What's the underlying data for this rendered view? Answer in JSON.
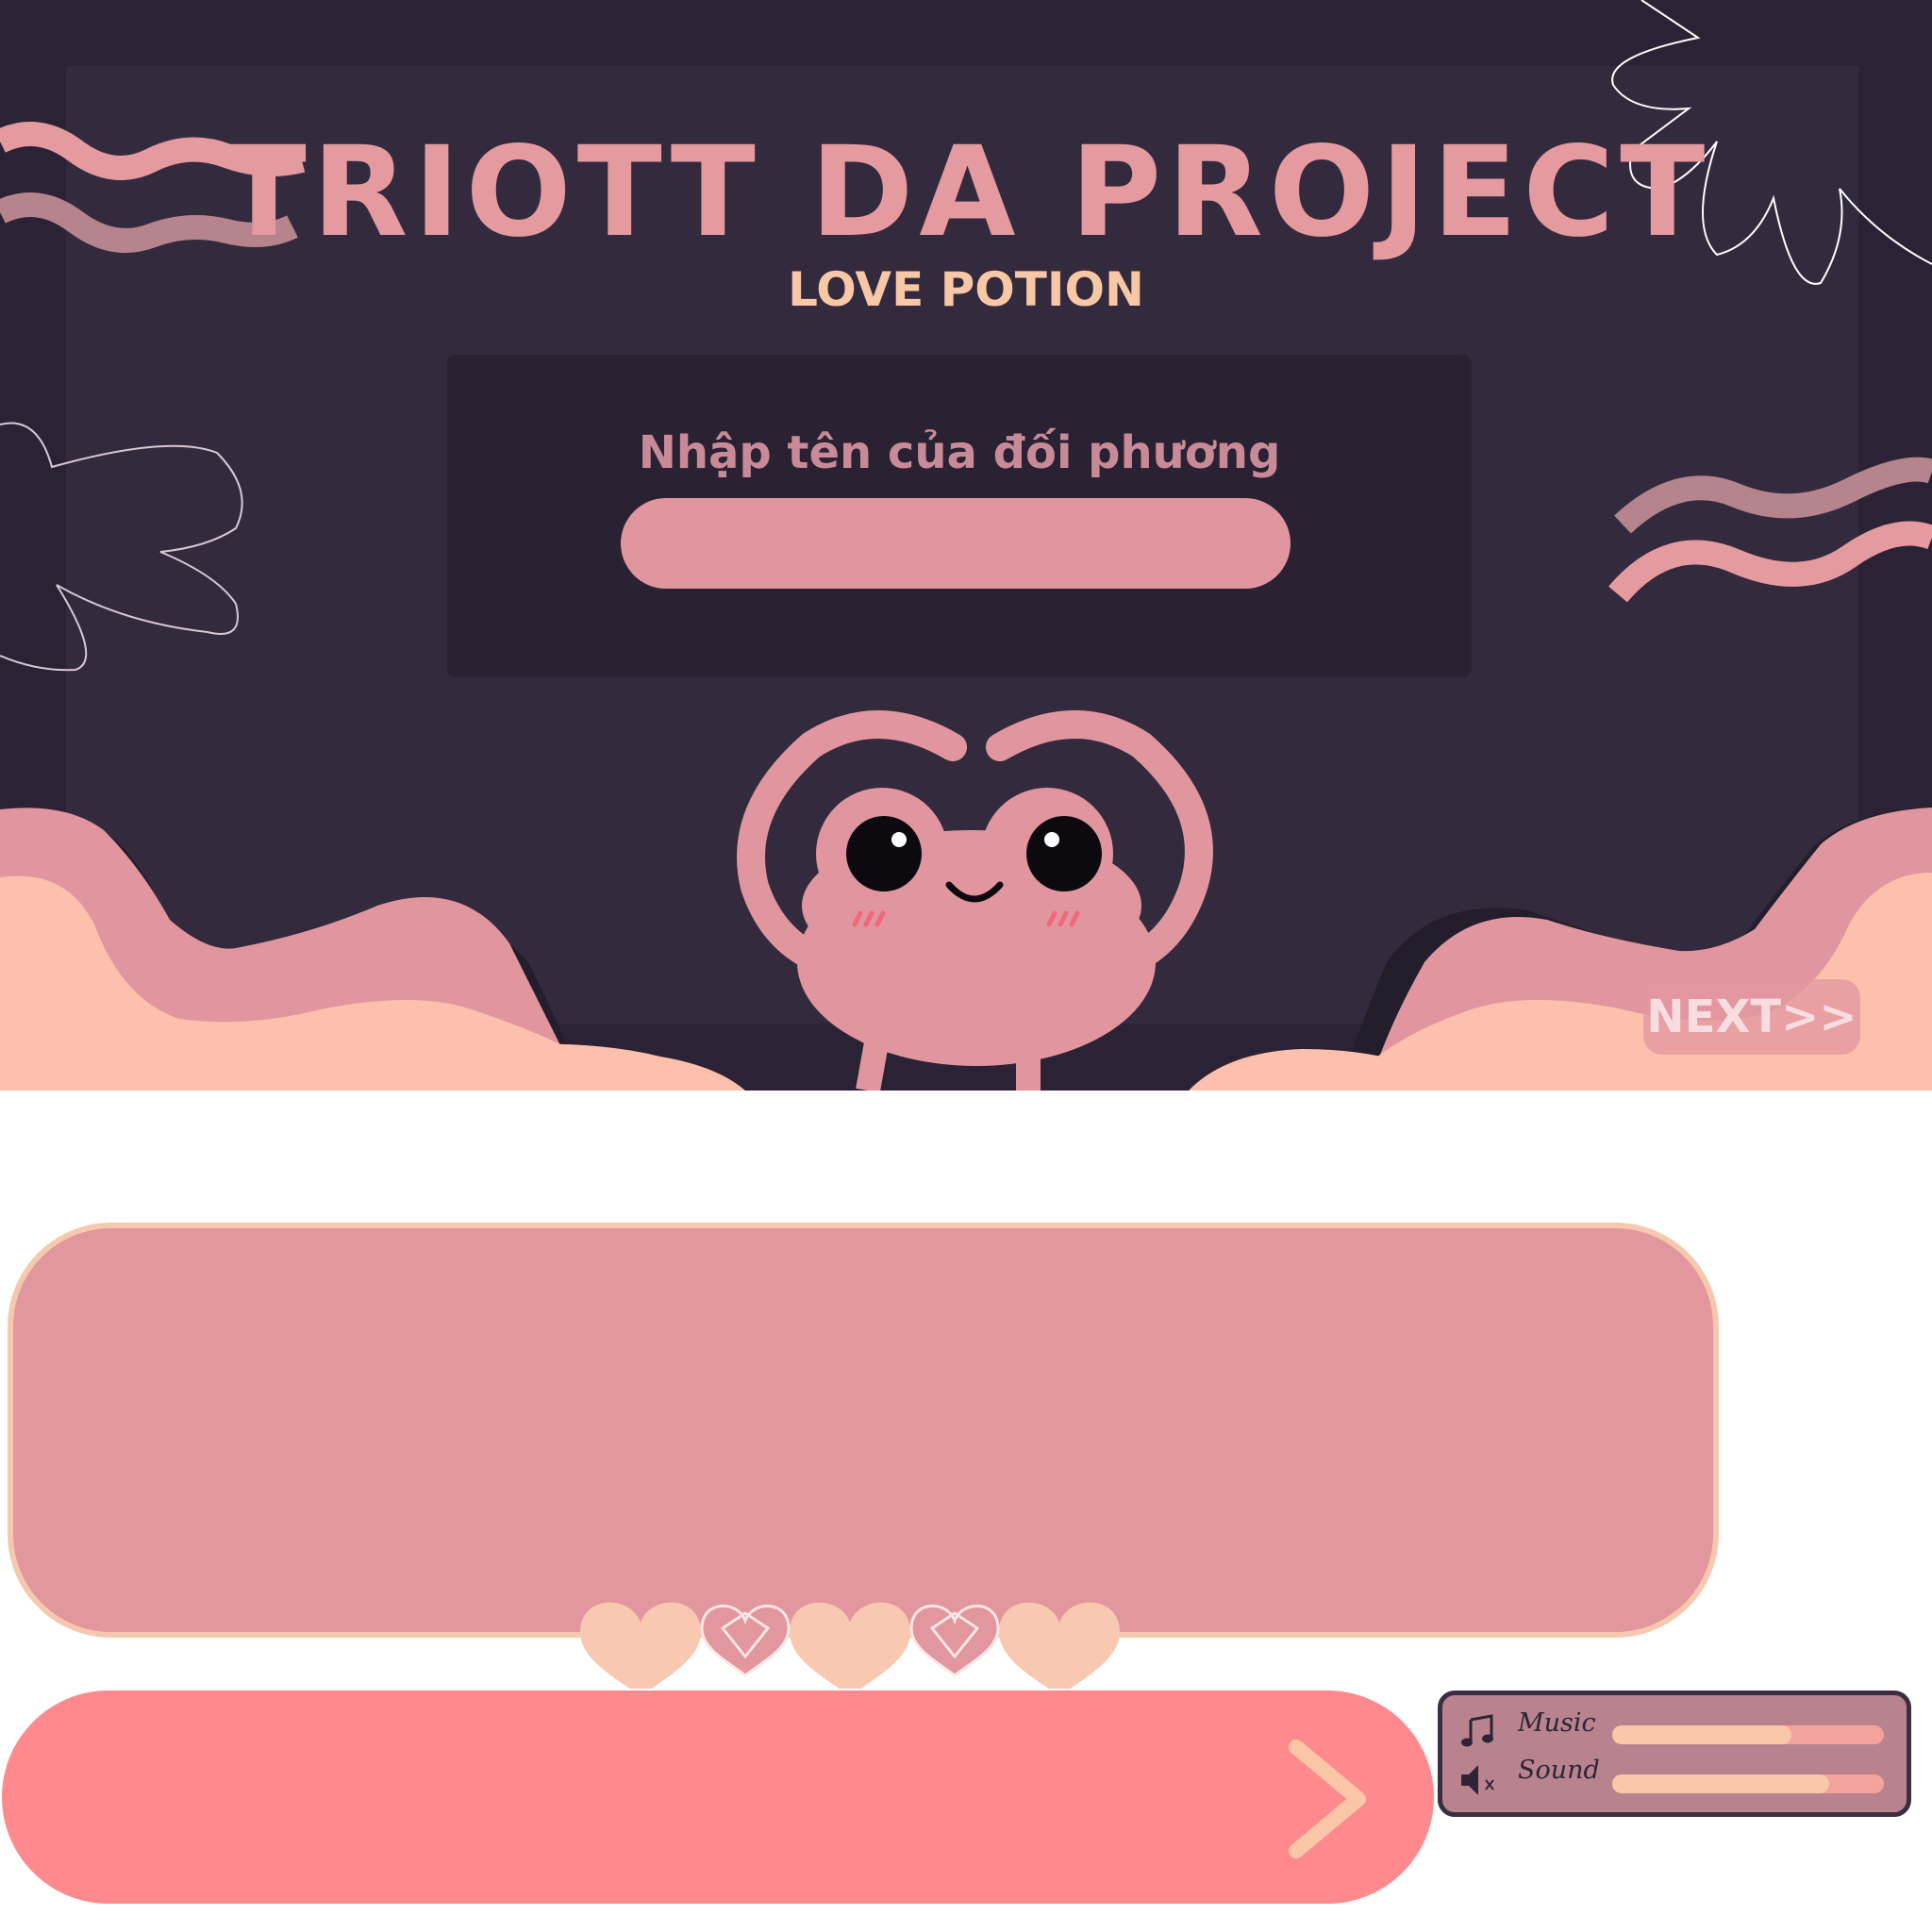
{
  "scene": {
    "title": "TRIOTT DA PROJECT",
    "subtitle": "LOVE POTION",
    "input_label": "Nhập tên của đối phương",
    "input_value": "",
    "input_placeholder": "",
    "next_label": "NEXT>>"
  },
  "dialog": {
    "text": ""
  },
  "choice": {
    "text": ""
  },
  "settings": {
    "music_label": "Music",
    "sound_label": "Sound",
    "music_level": 0.66,
    "sound_level": 0.8,
    "music_icon": "music-note-icon",
    "sound_icon": "speaker-muted-icon"
  },
  "colors": {
    "background": "#2b2335",
    "accent_pink": "#e2969d",
    "peach": "#f8c8a6",
    "coral": "#ff8a8d"
  }
}
